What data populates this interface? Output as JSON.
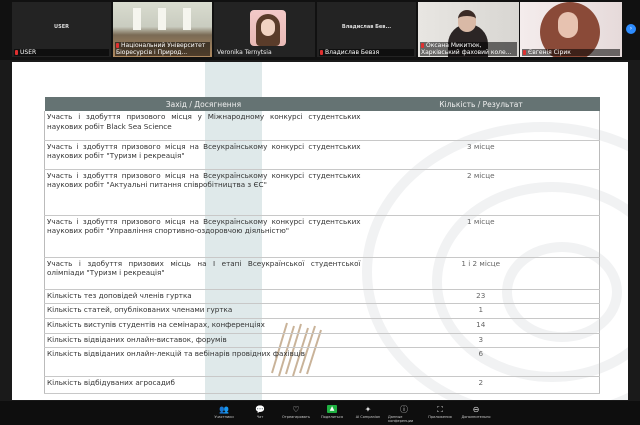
{
  "gallery": {
    "participants": [
      {
        "center_name": "USER",
        "label": "USER"
      },
      {
        "label": "Національний Університет Біоресурсів і Природ..."
      },
      {
        "label": "Veronika Ternytsia"
      },
      {
        "center_name": "Владислав Бев...",
        "label": "Владислав Бевзя"
      },
      {
        "label": "Оксана Микитюк, Харківський фаховий коле..."
      },
      {
        "label": "Євгенія Сірик"
      }
    ],
    "next_icon": "chevron-right-icon"
  },
  "table": {
    "headers": [
      "Захід / Досягнення",
      "Кількість / Результат"
    ],
    "rows": [
      {
        "event": "Участь і здобуття призового місця у Міжнародному конкурсі студентських наукових робіт Black Sea Science",
        "result": ""
      },
      {
        "event": "Участь і здобуття призового місця на Всеукраїнському конкурсі студентських наукових  робіт \"Туризм і рекреація\"",
        "result": "3 місце"
      },
      {
        "event": "Участь і здобуття призового місця на Всеукраїнському конкурсі студентських наукових  робіт \"Актуальні питання співробітництва з ЄС\"",
        "result": "2 місце"
      },
      {
        "event": "Участь і здобуття призового місця на Всеукраїнському конкурсі студентських наукових  робіт \"Управління спортивно-оздоровчою діяльністю\"",
        "result": "1 місце"
      },
      {
        "event": "Участь і здобуття призових місць на І етапі Всеукраїнської студентської олімпіади \"Туризм і рекреація\"",
        "result": "1 і 2 місце"
      },
      {
        "event": "Кількість тез доповідей членів гуртка",
        "result": "23"
      },
      {
        "event": "Кількість статей, опублікованих членами гуртка",
        "result": "1"
      },
      {
        "event": "Кількість виступів студентів на семінарах, конференціях",
        "result": "14"
      },
      {
        "event": "Кількість відвіданих онлайн-виставок, форумів",
        "result": "3"
      },
      {
        "event": "Кількість відвіданих онлайн-лекцій та вебінарів провідних фахівців",
        "result": "6"
      },
      {
        "event": "Кількість відбідуваних агросадиб",
        "result": "2"
      }
    ]
  },
  "toolbar": [
    {
      "label": "Участники",
      "icon": "participants-icon",
      "glyph": "👥"
    },
    {
      "label": "Чат",
      "icon": "chat-icon",
      "glyph": "💬"
    },
    {
      "label": "Отреагировать",
      "icon": "reaction-icon",
      "glyph": "♡"
    },
    {
      "label": "Поделиться",
      "icon": "share-screen-icon",
      "glyph": "▲"
    },
    {
      "label": "AI Companion",
      "icon": "ai-companion-icon",
      "glyph": "✦"
    },
    {
      "label": "Данные конференции",
      "icon": "info-icon",
      "glyph": "ⓘ"
    },
    {
      "label": "Приложения",
      "icon": "apps-icon",
      "glyph": "⛶"
    },
    {
      "label": "Дополнительно",
      "icon": "more-icon",
      "glyph": "⊖"
    }
  ]
}
